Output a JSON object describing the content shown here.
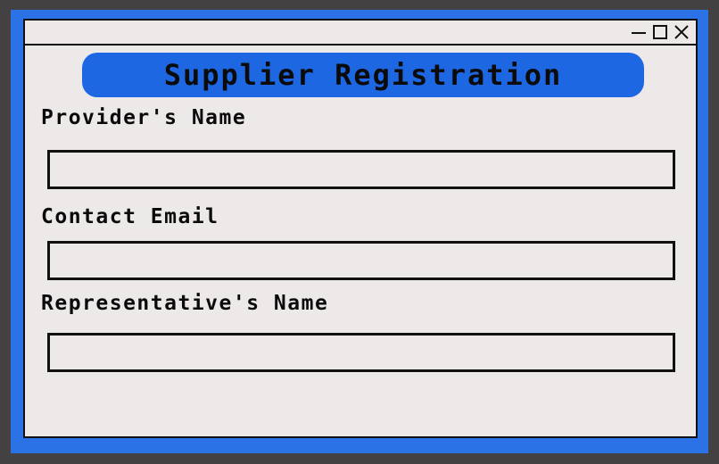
{
  "window": {
    "controls": {
      "minimize_icon": "minimize-icon",
      "maximize_icon": "maximize-icon",
      "close_icon": "close-icon"
    }
  },
  "form": {
    "title": "Supplier Registration",
    "fields": [
      {
        "label": "Provider's Name",
        "value": "",
        "placeholder": ""
      },
      {
        "label": "Contact Email",
        "value": "",
        "placeholder": ""
      },
      {
        "label": "Representative's Name",
        "value": "",
        "placeholder": ""
      }
    ]
  },
  "colors": {
    "accent": "#2a72e6",
    "heading_bg": "#1e67e3",
    "window_bg": "#ede9e8",
    "outer_bg": "#444143"
  }
}
